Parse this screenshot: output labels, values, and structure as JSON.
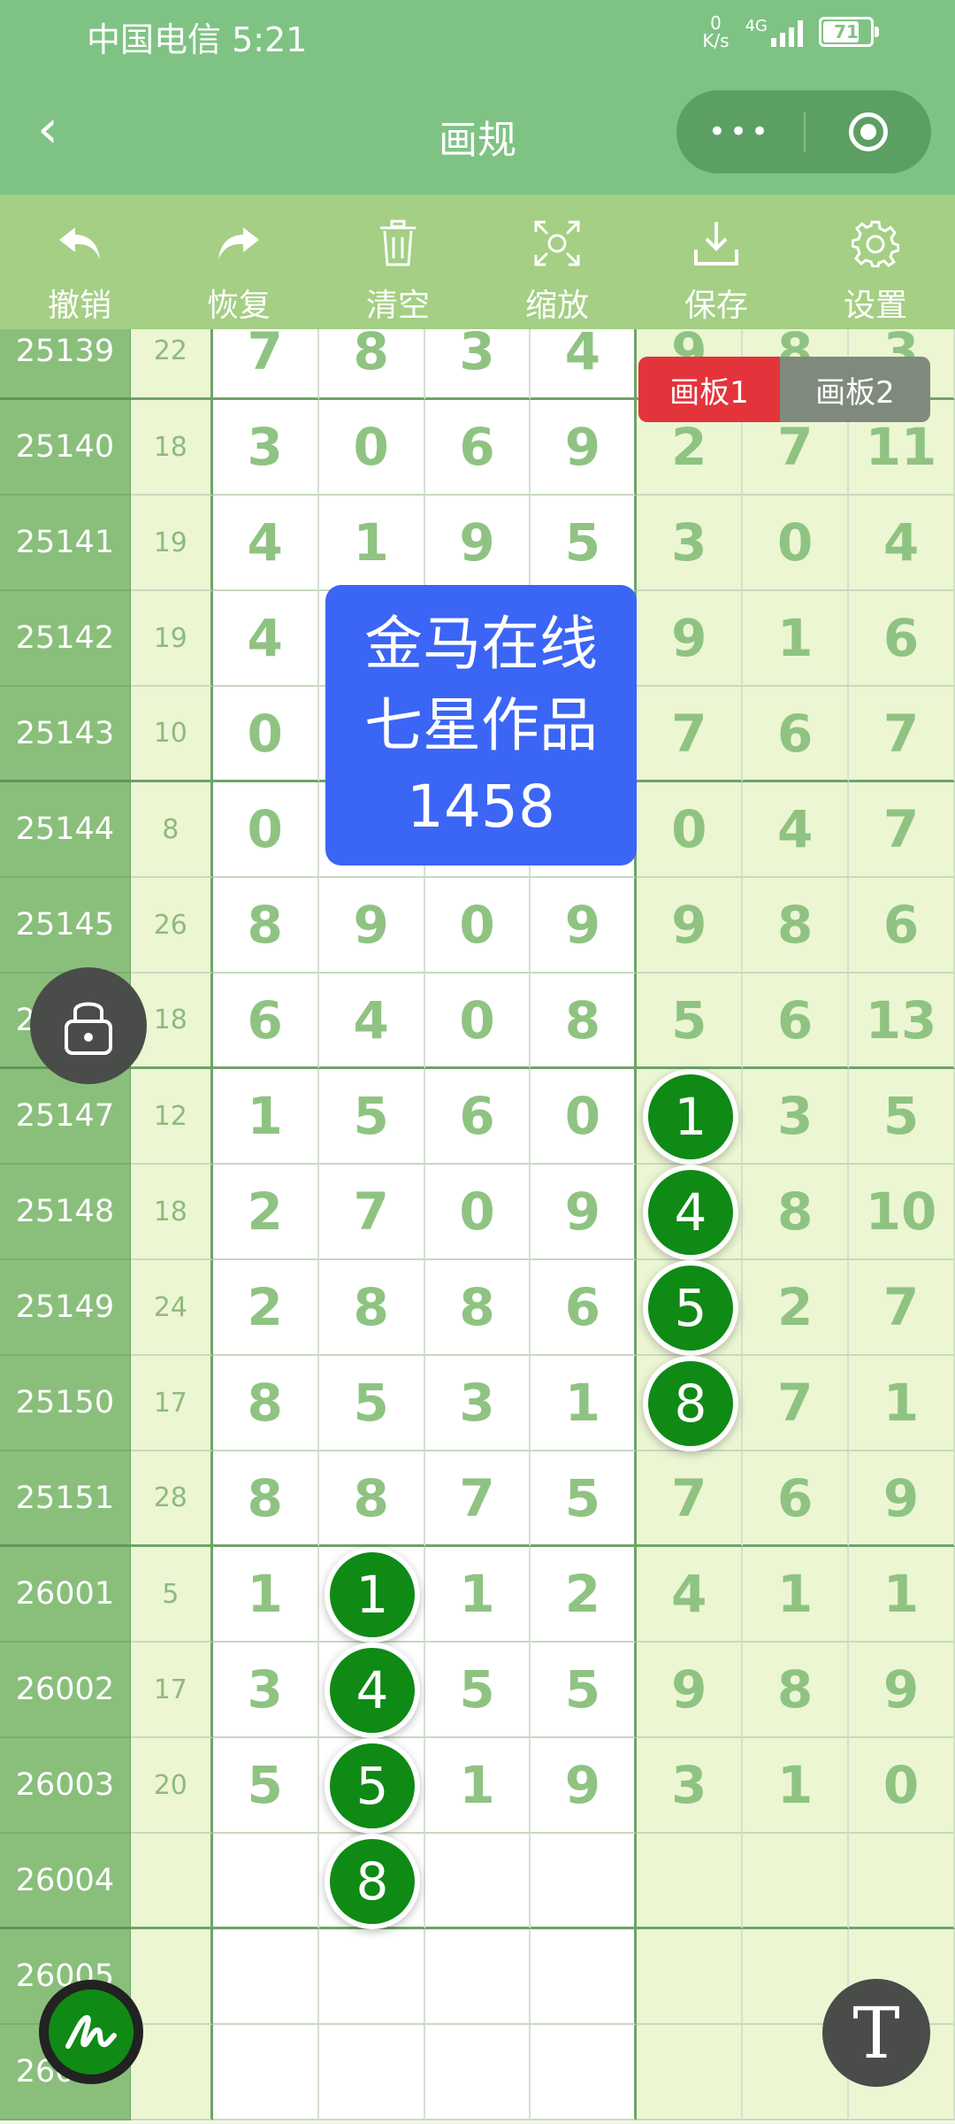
{
  "status": {
    "carrier": "中国电信 5:21",
    "speed_value": "0",
    "speed_unit": "K/s",
    "network": "4G",
    "battery": "71"
  },
  "nav": {
    "title": "画规",
    "more": "•••"
  },
  "toolbar": [
    {
      "label": "撤销",
      "icon": "undo-icon"
    },
    {
      "label": "恢复",
      "icon": "redo-icon"
    },
    {
      "label": "清空",
      "icon": "trash-icon"
    },
    {
      "label": "缩放",
      "icon": "zoom-icon"
    },
    {
      "label": "保存",
      "icon": "download-icon"
    },
    {
      "label": "设置",
      "icon": "gear-icon"
    }
  ],
  "tabs": {
    "tab1": "画板1",
    "tab2": "画板2"
  },
  "badge": {
    "line1": "金马在线",
    "line2": "七星作品",
    "line3": "1458"
  },
  "rows": [
    {
      "issue": "25139",
      "sum": "22",
      "w": [
        "7",
        "8",
        "3",
        "4"
      ],
      "g": [
        "9",
        "8",
        "3"
      ]
    },
    {
      "issue": "25140",
      "sum": "18",
      "w": [
        "3",
        "0",
        "6",
        "9"
      ],
      "g": [
        "2",
        "7",
        "11"
      ]
    },
    {
      "issue": "25141",
      "sum": "19",
      "w": [
        "4",
        "1",
        "9",
        "5"
      ],
      "g": [
        "3",
        "0",
        "4"
      ]
    },
    {
      "issue": "25142",
      "sum": "19",
      "w": [
        "4",
        "",
        "",
        ""
      ],
      "g": [
        "9",
        "1",
        "6"
      ]
    },
    {
      "issue": "25143",
      "sum": "10",
      "w": [
        "0",
        "",
        "",
        ""
      ],
      "g": [
        "7",
        "6",
        "7"
      ]
    },
    {
      "issue": "25144",
      "sum": "8",
      "w": [
        "0",
        "",
        "",
        ""
      ],
      "g": [
        "0",
        "4",
        "7"
      ]
    },
    {
      "issue": "25145",
      "sum": "26",
      "w": [
        "8",
        "9",
        "0",
        "9"
      ],
      "g": [
        "9",
        "8",
        "6"
      ]
    },
    {
      "issue": "25146",
      "sum": "18",
      "w": [
        "6",
        "4",
        "0",
        "8"
      ],
      "g": [
        "5",
        "6",
        "13"
      ]
    },
    {
      "issue": "25147",
      "sum": "12",
      "w": [
        "1",
        "5",
        "6",
        "0"
      ],
      "g": [
        "",
        "3",
        "5"
      ]
    },
    {
      "issue": "25148",
      "sum": "18",
      "w": [
        "2",
        "7",
        "0",
        "9"
      ],
      "g": [
        "",
        "8",
        "10"
      ]
    },
    {
      "issue": "25149",
      "sum": "24",
      "w": [
        "2",
        "8",
        "8",
        "6"
      ],
      "g": [
        "",
        "2",
        "7"
      ]
    },
    {
      "issue": "25150",
      "sum": "17",
      "w": [
        "8",
        "5",
        "3",
        "1"
      ],
      "g": [
        "",
        "7",
        "1"
      ]
    },
    {
      "issue": "25151",
      "sum": "28",
      "w": [
        "8",
        "8",
        "7",
        "5"
      ],
      "g": [
        "7",
        "6",
        "9"
      ]
    },
    {
      "issue": "26001",
      "sum": "5",
      "w": [
        "1",
        "",
        "1",
        "2"
      ],
      "g": [
        "4",
        "1",
        "1"
      ]
    },
    {
      "issue": "26002",
      "sum": "17",
      "w": [
        "3",
        "",
        "5",
        "5"
      ],
      "g": [
        "9",
        "8",
        "9"
      ]
    },
    {
      "issue": "26003",
      "sum": "20",
      "w": [
        "5",
        "",
        "1",
        "9"
      ],
      "g": [
        "3",
        "1",
        "0"
      ]
    },
    {
      "issue": "26004",
      "sum": "",
      "w": [
        "",
        "",
        "",
        ""
      ],
      "g": [
        "",
        "",
        ""
      ]
    },
    {
      "issue": "26005",
      "sum": "",
      "w": [
        "",
        "",
        "",
        ""
      ],
      "g": [
        "",
        "",
        ""
      ]
    },
    {
      "issue": "26006",
      "sum": "",
      "w": [
        "",
        "",
        "",
        ""
      ],
      "g": [
        "",
        "",
        ""
      ]
    }
  ],
  "balls_right": [
    "1",
    "4",
    "5",
    "8"
  ],
  "balls_left": [
    "1",
    "4",
    "5",
    "8"
  ]
}
